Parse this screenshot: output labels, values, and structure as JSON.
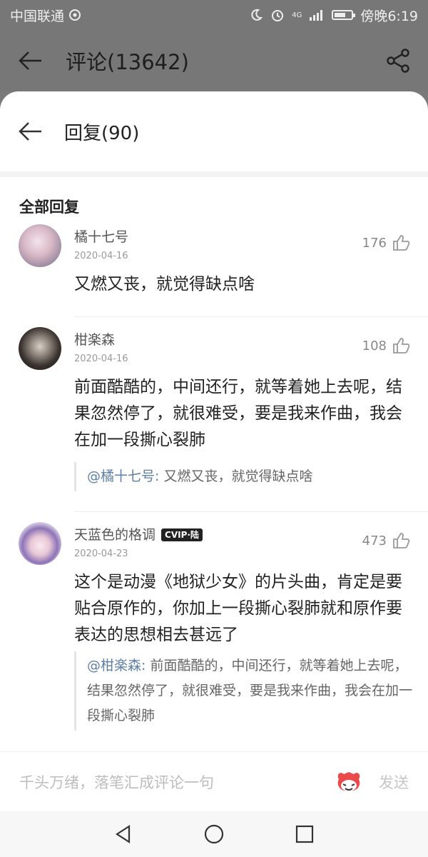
{
  "status_bar": {
    "carrier": "中国联通",
    "network": "4G",
    "time": "傍晚6:19",
    "battery_level": 0.55
  },
  "header": {
    "title": "评论(13642)"
  },
  "sheet": {
    "title": "回复(90)"
  },
  "section": {
    "title": "全部回复"
  },
  "comments": [
    {
      "name": "橘十七号",
      "date": "2020-04-16",
      "likes": "176",
      "text": "又燃又丧，就觉得缺点啥"
    },
    {
      "name": "柑楽森",
      "date": "2020-04-16",
      "likes": "108",
      "text": "前面酷酷的，中间还行，就等着她上去呢，结果忽然停了，就很难受，要是我来作曲，我会在加一段撕心裂肺",
      "quote": {
        "who": "@橘十七号:",
        "text": " 又燃又丧，就觉得缺点啥"
      }
    },
    {
      "name": "天蓝色的格调",
      "badge": "CVIP·陆",
      "date": "2020-04-23",
      "likes": "473",
      "text": "这个是动漫《地狱少女》的片头曲，肯定是要贴合原作的，你加上一段撕心裂肺就和原作要表达的思想相去甚远了",
      "quote": {
        "who": "@柑楽森:",
        "text": " 前面酷酷的，中间还行，就等着她上去呢，结果忽然停了，就很难受，要是我来作曲，我会在加一段撕心裂肺"
      }
    }
  ],
  "input": {
    "placeholder": "千头万绪，落笔汇成评论一句",
    "send": "发送"
  }
}
